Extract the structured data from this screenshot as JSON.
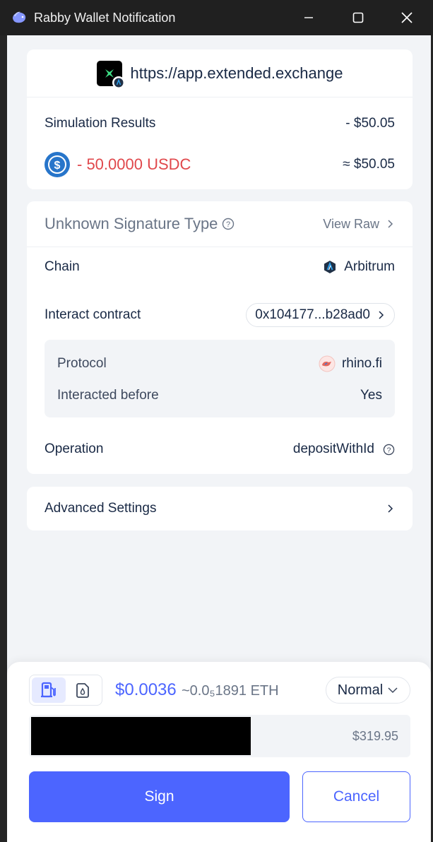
{
  "window": {
    "title": "Rabby Wallet Notification"
  },
  "site": {
    "url": "https://app.extended.exchange"
  },
  "simulation": {
    "title": "Simulation Results",
    "total": "- $50.05",
    "token_amount": "- 50.0000 USDC",
    "token_value": "≈ $50.05"
  },
  "signature": {
    "type_label": "Unknown Signature Type",
    "view_raw": "View Raw",
    "chain_label": "Chain",
    "chain_value": "Arbitrum",
    "contract_label": "Interact contract",
    "contract_value": "0x104177...b28ad0",
    "protocol_label": "Protocol",
    "protocol_value": "rhino.fi",
    "interacted_label": "Interacted before",
    "interacted_value": "Yes",
    "operation_label": "Operation",
    "operation_value": "depositWithId"
  },
  "advanced": {
    "label": "Advanced Settings"
  },
  "gas": {
    "cost": "$0.0036",
    "eth": "~0.0₅1891 ETH",
    "speed": "Normal",
    "balance": "$319.95"
  },
  "actions": {
    "sign": "Sign",
    "cancel": "Cancel"
  },
  "colors": {
    "accent": "#4c65ff",
    "negative": "#e0474b",
    "usdc": "#2775ca",
    "text": "#192945"
  }
}
